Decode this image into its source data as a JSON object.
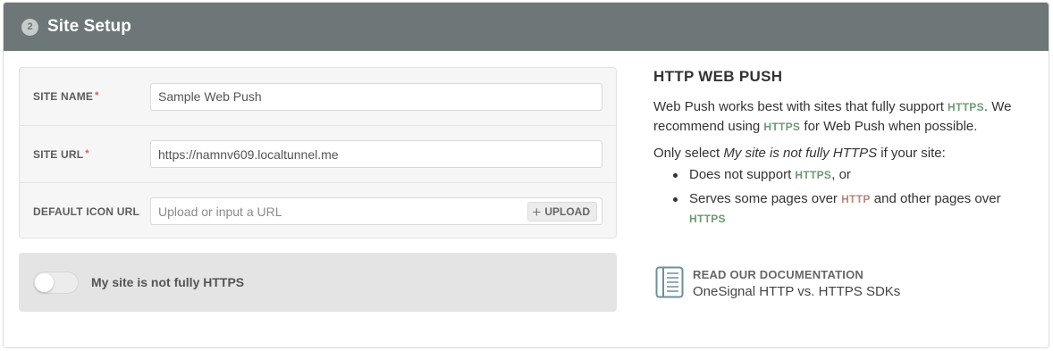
{
  "header": {
    "step_number": "2",
    "title": "Site Setup"
  },
  "form": {
    "site_name": {
      "label": "SITE NAME",
      "required_mark": "*",
      "value": "Sample Web Push"
    },
    "site_url": {
      "label": "SITE URL",
      "required_mark": "*",
      "value": "https://namnv609.localtunnel.me"
    },
    "default_icon_url": {
      "label": "DEFAULT ICON URL",
      "placeholder": "Upload or input a URL",
      "upload_label": "UPLOAD",
      "upload_icon": "plus-icon"
    }
  },
  "toggle": {
    "label": "My site is not fully HTTPS",
    "checked": false
  },
  "info": {
    "title": "HTTP WEB PUSH",
    "p1_a": "Web Push works best with sites that fully support ",
    "p1_https": "HTTPS",
    "p1_b": ". We recommend using ",
    "p1_https2": "HTTPS",
    "p1_c": " for Web Push when possible.",
    "p2_a": "Only select ",
    "p2_em": "My site is not fully HTTPS",
    "p2_b": " if your site:",
    "bullet1_a": "Does not support ",
    "bullet1_https": "HTTPS",
    "bullet1_b": ", or",
    "bullet2_a": "Serves some pages over ",
    "bullet2_http": "HTTP",
    "bullet2_b": " and other pages over ",
    "bullet2_https": "HTTPS"
  },
  "docs": {
    "icon": "document-icon",
    "heading": "READ OUR DOCUMENTATION",
    "link": "OneSignal HTTP vs. HTTPS SDKs"
  },
  "colors": {
    "header_bg": "#6d7777",
    "https_green": "#6b9c73",
    "http_red": "#b6867a",
    "required_red": "#e5534b"
  }
}
